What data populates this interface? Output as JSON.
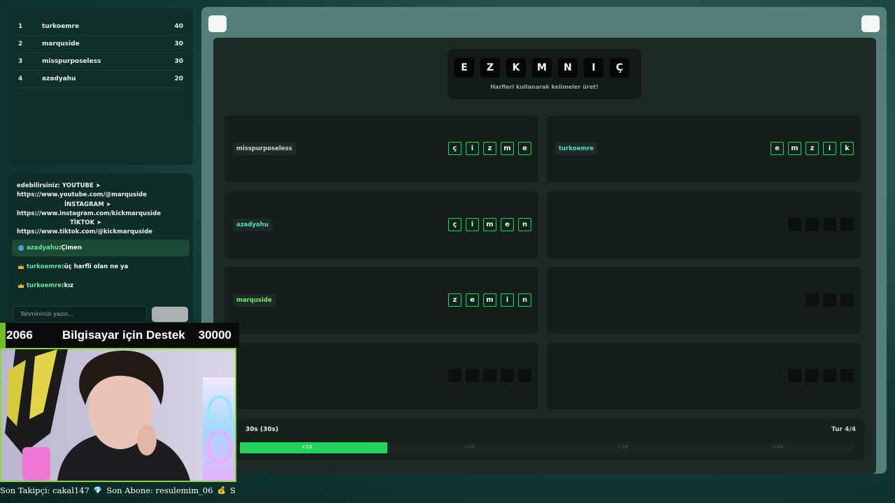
{
  "leaderboard": [
    {
      "rank": "1",
      "name": "turkoemre",
      "score": "40"
    },
    {
      "rank": "2",
      "name": "marquside",
      "score": "30"
    },
    {
      "rank": "3",
      "name": "misspurposeless",
      "score": "30"
    },
    {
      "rank": "4",
      "name": "azadyahu",
      "score": "20"
    }
  ],
  "chat": {
    "system_lines": [
      "edebilirsiniz: YOUTUBE ➤",
      "https://www.youtube.com/@marquside",
      "İNSTAGRAM ➤",
      "https://www.instagram.com/kickmarquside",
      "TİKTOK ➤",
      "https://www.tiktok.com/@kickmarquside"
    ],
    "messages": [
      {
        "icon": "globe-icon",
        "user": "azadyahu",
        "sep": ":",
        "text": "Çimen",
        "highlight": true
      },
      {
        "icon": "crown-icon",
        "user": "turkoemre",
        "sep": ":",
        "text": "üç harfli olan ne ya",
        "highlight": false
      },
      {
        "icon": "crown-icon",
        "user": "turkoemre",
        "sep": ":",
        "text": "kız",
        "highlight": false
      }
    ],
    "input_placeholder": "Tahmininizi yazın...",
    "send_label": ""
  },
  "game": {
    "letters": [
      "E",
      "Z",
      "K",
      "M",
      "N",
      "I",
      "Ç"
    ],
    "hint": "Harfleri kullanarak kelimeler üret!",
    "cells": [
      {
        "player": "misspurposeless",
        "player_color": "#c9d3cf",
        "tiles": [
          "ç",
          "i",
          "z",
          "m",
          "e"
        ],
        "filled": true
      },
      {
        "player": "turkoemre",
        "player_color": "#4fe0b8",
        "tiles": [
          "e",
          "m",
          "z",
          "i",
          "k"
        ],
        "filled": true
      },
      {
        "player": "azadyahu",
        "player_color": "#4fe0b8",
        "tiles": [
          "ç",
          "i",
          "m",
          "e",
          "n"
        ],
        "filled": true
      },
      {
        "player": "",
        "player_color": "",
        "tiles": [
          "",
          "",
          "",
          ""
        ],
        "filled": false
      },
      {
        "player": "marquside",
        "player_color": "#6bf06b",
        "tiles": [
          "z",
          "e",
          "m",
          "i",
          "n"
        ],
        "filled": true
      },
      {
        "player": "",
        "player_color": "",
        "tiles": [
          "",
          "",
          ""
        ],
        "filled": false
      },
      {
        "player": "",
        "player_color": "",
        "tiles": [
          "",
          "",
          "",
          "",
          ""
        ],
        "filled": false
      },
      {
        "player": "",
        "player_color": "",
        "tiles": [
          "",
          "",
          "",
          ""
        ],
        "filled": false
      }
    ],
    "timer_label": "30s (30s)",
    "round_label": "Tur 4/4",
    "progress_fraction": 0.24,
    "segments": [
      "+10",
      "+20",
      "+30",
      "+40"
    ]
  },
  "stream": {
    "goal_current": "2066",
    "goal_title": "Bilgisayar için Destek",
    "goal_target": "30000",
    "ticker": [
      {
        "icon": "",
        "text": "Son Takipçi: cakal147"
      },
      {
        "icon": "💎",
        "text": "Son Abone: resulemim_06"
      },
      {
        "icon": "💰",
        "text": "S"
      }
    ]
  },
  "colors": {
    "accent_green": "#22d35a",
    "frame": "#557f78"
  }
}
